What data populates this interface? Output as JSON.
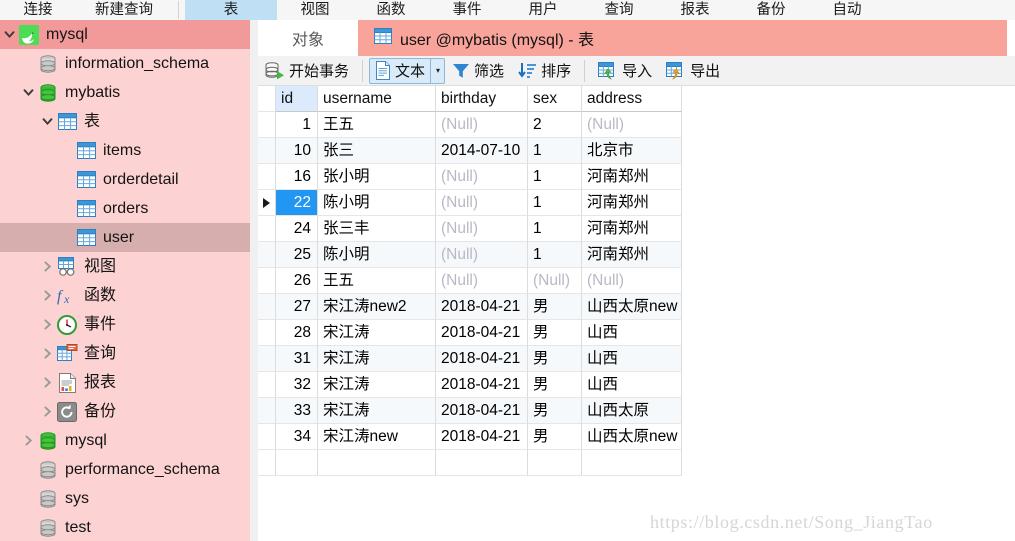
{
  "main_toolbar": {
    "items": [
      {
        "label": "连接",
        "name": "connection",
        "active": false,
        "sep_after": false
      },
      {
        "label": "新建查询",
        "name": "new-query",
        "active": false,
        "sep_after": true
      },
      {
        "label": "表",
        "name": "table",
        "active": true,
        "sep_after": false
      },
      {
        "label": "视图",
        "name": "view",
        "active": false,
        "sep_after": false
      },
      {
        "label": "函数",
        "name": "function",
        "active": false,
        "sep_after": false
      },
      {
        "label": "事件",
        "name": "event",
        "active": false,
        "sep_after": false
      },
      {
        "label": "用户",
        "name": "user",
        "active": false,
        "sep_after": false
      },
      {
        "label": "查询",
        "name": "query",
        "active": false,
        "sep_after": false
      },
      {
        "label": "报表",
        "name": "report",
        "active": false,
        "sep_after": false
      },
      {
        "label": "备份",
        "name": "backup",
        "active": false,
        "sep_after": false
      },
      {
        "label": "自动",
        "name": "automation",
        "active": false,
        "sep_after": false
      }
    ]
  },
  "sidebar": {
    "items": [
      {
        "label": "mysql",
        "icon": "mysql-dolphin-icon",
        "indent": 0,
        "twisty": "down",
        "state": "sel-strong",
        "name": "tree-item-connection-mysql"
      },
      {
        "label": "information_schema",
        "icon": "database-gray-icon",
        "indent": 1,
        "twisty": "none",
        "state": "",
        "name": "tree-item-db-information-schema"
      },
      {
        "label": "mybatis",
        "icon": "database-green-icon",
        "indent": 1,
        "twisty": "down",
        "state": "",
        "name": "tree-item-db-mybatis"
      },
      {
        "label": "表",
        "icon": "table-folder-icon",
        "indent": 2,
        "twisty": "down",
        "state": "",
        "name": "tree-item-tables"
      },
      {
        "label": "items",
        "icon": "table-icon",
        "indent": 3,
        "twisty": "none",
        "state": "",
        "name": "tree-item-table-items"
      },
      {
        "label": "orderdetail",
        "icon": "table-icon",
        "indent": 3,
        "twisty": "none",
        "state": "",
        "name": "tree-item-table-orderdetail"
      },
      {
        "label": "orders",
        "icon": "table-icon",
        "indent": 3,
        "twisty": "none",
        "state": "",
        "name": "tree-item-table-orders"
      },
      {
        "label": "user",
        "icon": "table-icon",
        "indent": 3,
        "twisty": "none",
        "state": "sel-soft",
        "name": "tree-item-table-user"
      },
      {
        "label": "视图",
        "icon": "view-icon",
        "indent": 2,
        "twisty": "right",
        "state": "",
        "name": "tree-item-views"
      },
      {
        "label": "函数",
        "icon": "function-fx-icon",
        "indent": 2,
        "twisty": "right",
        "state": "",
        "name": "tree-item-functions"
      },
      {
        "label": "事件",
        "icon": "clock-icon",
        "indent": 2,
        "twisty": "right",
        "state": "",
        "name": "tree-item-events"
      },
      {
        "label": "查询",
        "icon": "query-icon",
        "indent": 2,
        "twisty": "right",
        "state": "",
        "name": "tree-item-queries"
      },
      {
        "label": "报表",
        "icon": "report-icon",
        "indent": 2,
        "twisty": "right",
        "state": "",
        "name": "tree-item-reports"
      },
      {
        "label": "备份",
        "icon": "backup-icon",
        "indent": 2,
        "twisty": "right",
        "state": "",
        "name": "tree-item-backups"
      },
      {
        "label": "mysql",
        "icon": "database-green-icon",
        "indent": 1,
        "twisty": "right",
        "state": "",
        "name": "tree-item-db-mysql"
      },
      {
        "label": "performance_schema",
        "icon": "database-gray-icon",
        "indent": 1,
        "twisty": "none",
        "state": "",
        "name": "tree-item-db-performance-schema"
      },
      {
        "label": "sys",
        "icon": "database-gray-icon",
        "indent": 1,
        "twisty": "none",
        "state": "",
        "name": "tree-item-db-sys"
      },
      {
        "label": "test",
        "icon": "database-gray-icon",
        "indent": 1,
        "twisty": "none",
        "state": "",
        "name": "tree-item-db-test"
      }
    ]
  },
  "tabs": {
    "objects_label": "对象",
    "active_label": "user @mybatis (mysql) - 表",
    "active_icon": "table-icon"
  },
  "actionbar": {
    "begin_transaction": "开始事务",
    "text": "文本",
    "filter": "筛选",
    "sort": "排序",
    "import": "导入",
    "export": "导出",
    "caret": "▾"
  },
  "grid": {
    "columns": [
      {
        "key": "id",
        "label": "id"
      },
      {
        "key": "username",
        "label": "username"
      },
      {
        "key": "birthday",
        "label": "birthday"
      },
      {
        "key": "sex",
        "label": "sex"
      },
      {
        "key": "address",
        "label": "address"
      }
    ],
    "null_text": "(Null)",
    "selected_id": "22",
    "rows": [
      {
        "id": "1",
        "username": "王五",
        "birthday": null,
        "sex": "2",
        "address": null
      },
      {
        "id": "10",
        "username": "张三",
        "birthday": "2014-07-10",
        "sex": "1",
        "address": "北京市"
      },
      {
        "id": "16",
        "username": "张小明",
        "birthday": null,
        "sex": "1",
        "address": "河南郑州"
      },
      {
        "id": "22",
        "username": "陈小明",
        "birthday": null,
        "sex": "1",
        "address": "河南郑州"
      },
      {
        "id": "24",
        "username": "张三丰",
        "birthday": null,
        "sex": "1",
        "address": "河南郑州"
      },
      {
        "id": "25",
        "username": "陈小明",
        "birthday": null,
        "sex": "1",
        "address": "河南郑州"
      },
      {
        "id": "26",
        "username": "王五",
        "birthday": null,
        "sex": null,
        "address": null
      },
      {
        "id": "27",
        "username": "宋江涛new2",
        "birthday": "2018-04-21",
        "sex": "男",
        "address": "山西太原new"
      },
      {
        "id": "28",
        "username": "宋江涛",
        "birthday": "2018-04-21",
        "sex": "男",
        "address": "山西"
      },
      {
        "id": "31",
        "username": "宋江涛",
        "birthday": "2018-04-21",
        "sex": "男",
        "address": "山西"
      },
      {
        "id": "32",
        "username": "宋江涛",
        "birthday": "2018-04-21",
        "sex": "男",
        "address": "山西"
      },
      {
        "id": "33",
        "username": "宋江涛",
        "birthday": "2018-04-21",
        "sex": "男",
        "address": "山西太原"
      },
      {
        "id": "34",
        "username": "宋江涛new",
        "birthday": "2018-04-21",
        "sex": "男",
        "address": "山西太原new"
      }
    ]
  },
  "watermark": {
    "text": "https://blog.csdn.net/Song_JiangTao"
  },
  "colors": {
    "sidebar_bg": "#fcd2d2",
    "sidebar_selected": "#f29a9a",
    "sidebar_selected_soft": "#d6aeae",
    "tab_active": "#f9a49a",
    "row_selected": "#2196f3",
    "header_id_highlight": "#dbeafc",
    "alt_row": "#f6f9fb",
    "toolbar_active": "#bfdff5"
  }
}
